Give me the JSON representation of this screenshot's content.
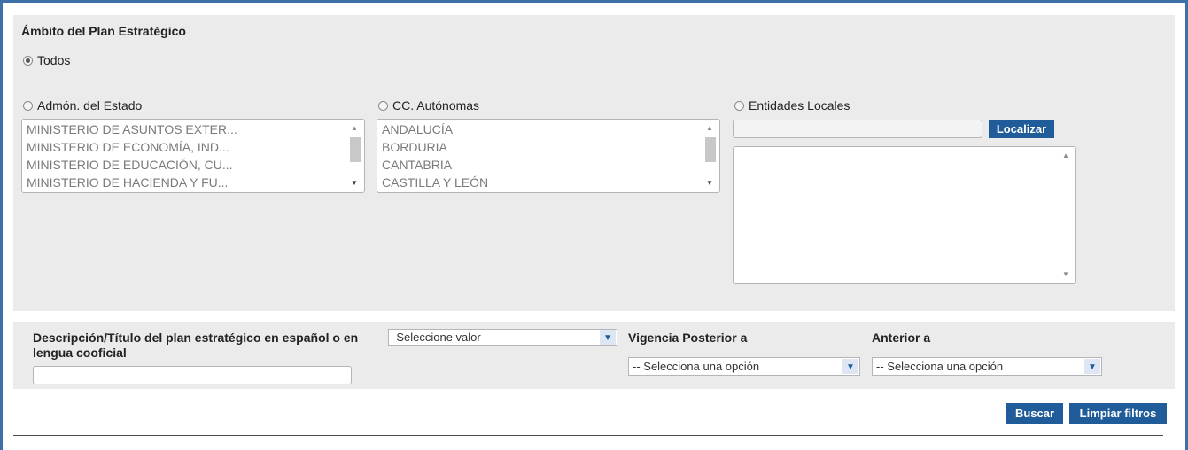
{
  "scope": {
    "title": "Ámbito del Plan Estratégico",
    "todos_label": "Todos",
    "estado": {
      "label": "Admón. del Estado",
      "items": [
        "MINISTERIO DE ASUNTOS EXTER...",
        "MINISTERIO DE ECONOMÍA, IND...",
        "MINISTERIO DE EDUCACIÓN, CU...",
        "MINISTERIO DE HACIENDA Y FU..."
      ]
    },
    "autonomas": {
      "label": "CC. Autónomas",
      "items": [
        "ANDALUCÍA",
        "BORDURIA",
        "CANTABRIA",
        "CASTILLA Y LEÓN"
      ]
    },
    "locales": {
      "label": "Entidades Locales",
      "search_value": "",
      "localizar_label": "Localizar"
    },
    "selected": "Todos"
  },
  "filters": {
    "descripcion_label": "Descripción/Título del plan estratégico en español o en lengua cooficial",
    "descripcion_value": "",
    "idioma_select": "-Seleccione valor",
    "vigencia_label": "Vigencia Posterior a",
    "vigencia_select": "-- Selecciona una opción",
    "anterior_label": "Anterior a",
    "anterior_select": "-- Selecciona una opción"
  },
  "actions": {
    "buscar_label": "Buscar",
    "limpiar_label": "Limpiar filtros"
  },
  "icons": {
    "dropdown": "chevron-down-icon",
    "scroll_up": "scroll-up-icon",
    "scroll_down": "scroll-down-icon",
    "radio": "radio-icon"
  },
  "colors": {
    "accent": "#1f5c99",
    "panel": "#ebebeb",
    "frame": "#3d6fa8"
  }
}
